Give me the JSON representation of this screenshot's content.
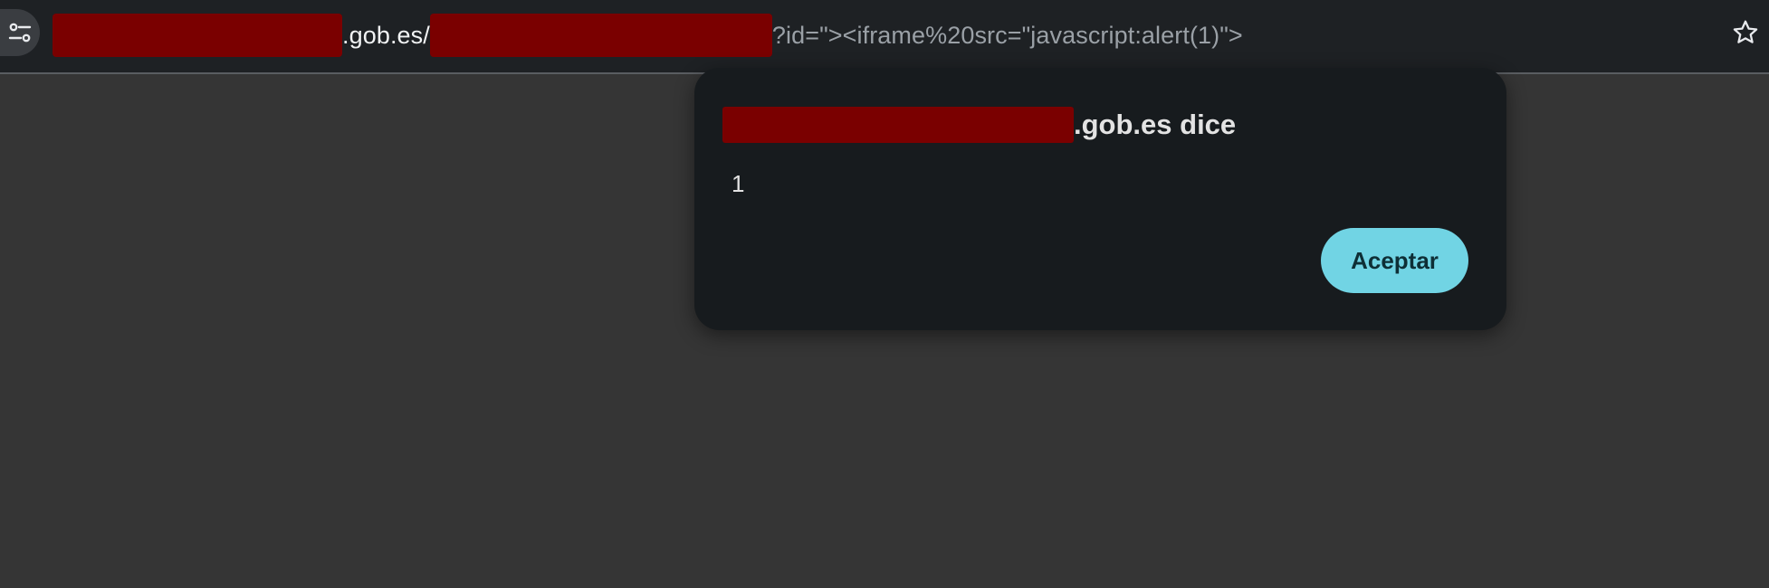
{
  "browser": {
    "url_host_suffix": ".gob.es/",
    "url_query": "?id=\"><iframe%20src=\"javascript:alert(1)\">",
    "icons": {
      "site_info": "tune-icon",
      "bookmark": "star-icon"
    },
    "redaction_color": "#7a0000"
  },
  "dialog": {
    "title_suffix": ".gob.es dice",
    "message": "1",
    "accept_label": "Aceptar",
    "accent_color": "#71d4e4"
  }
}
